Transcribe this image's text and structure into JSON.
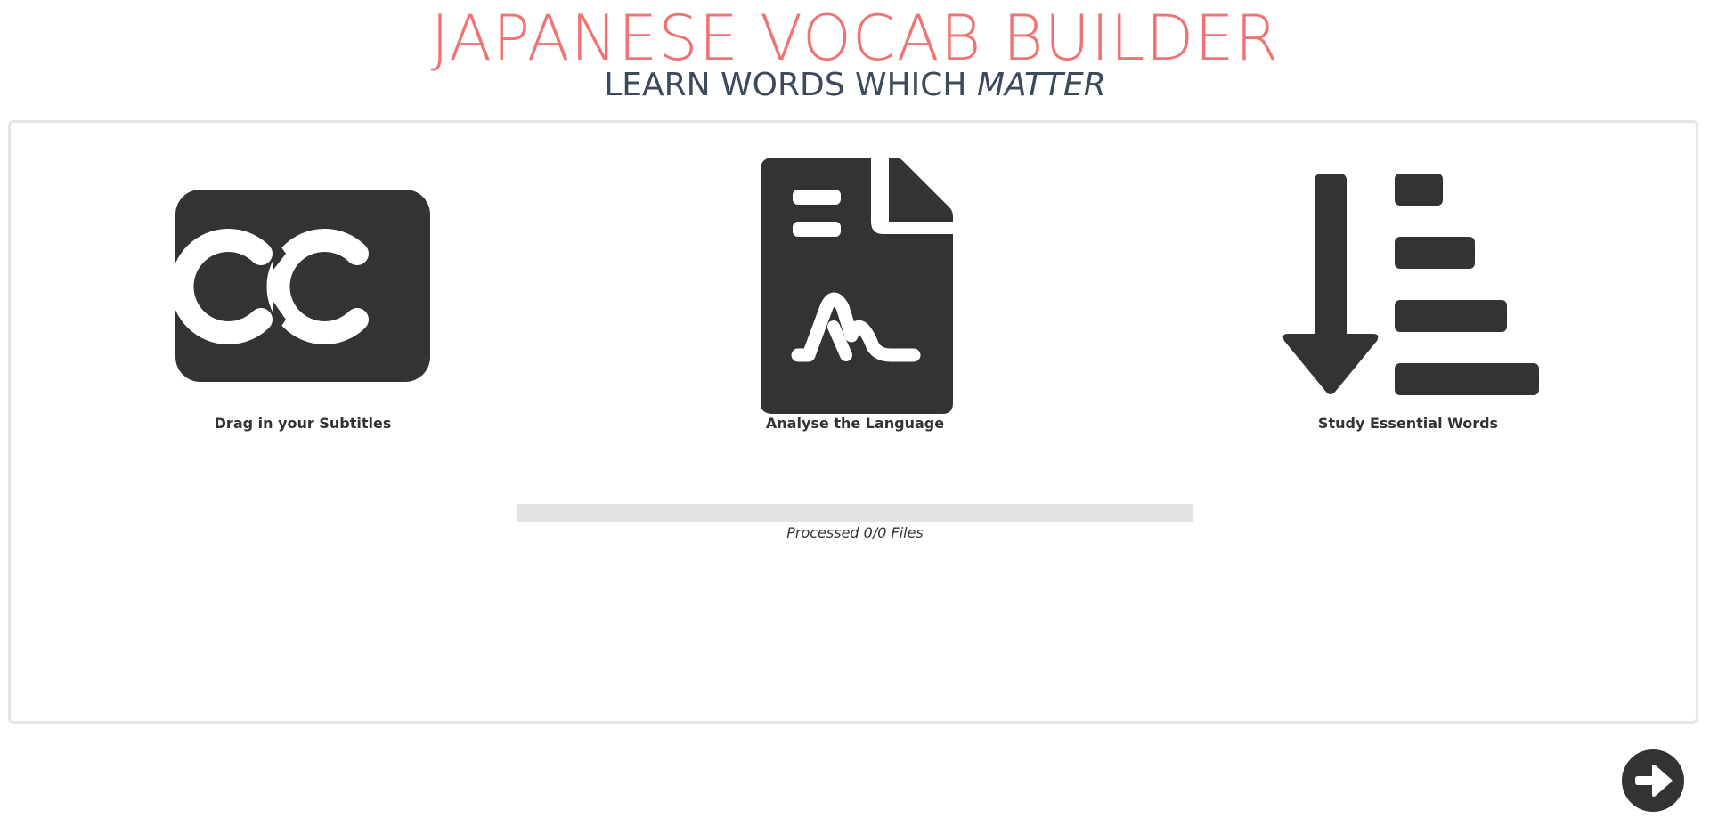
{
  "header": {
    "title": "JAPANESE VOCAB BUILDER",
    "subtitle_plain": "LEARN WORDS WHICH ",
    "subtitle_emphasis": "MATTER"
  },
  "steps": [
    {
      "label": "Drag in your Subtitles",
      "icon": "closed-captions-icon"
    },
    {
      "label": "Analyse the Language",
      "icon": "signed-document-icon"
    },
    {
      "label": "Study Essential Words",
      "icon": "sort-descending-icon"
    }
  ],
  "progress": {
    "text": "Processed 0/0 Files",
    "fraction": 0
  },
  "next": {
    "icon": "arrow-right-icon"
  },
  "colors": {
    "title": "#f07373",
    "subtitle": "#3d4a5c",
    "icon": "#333333",
    "progress_track": "#e3e3e3"
  }
}
